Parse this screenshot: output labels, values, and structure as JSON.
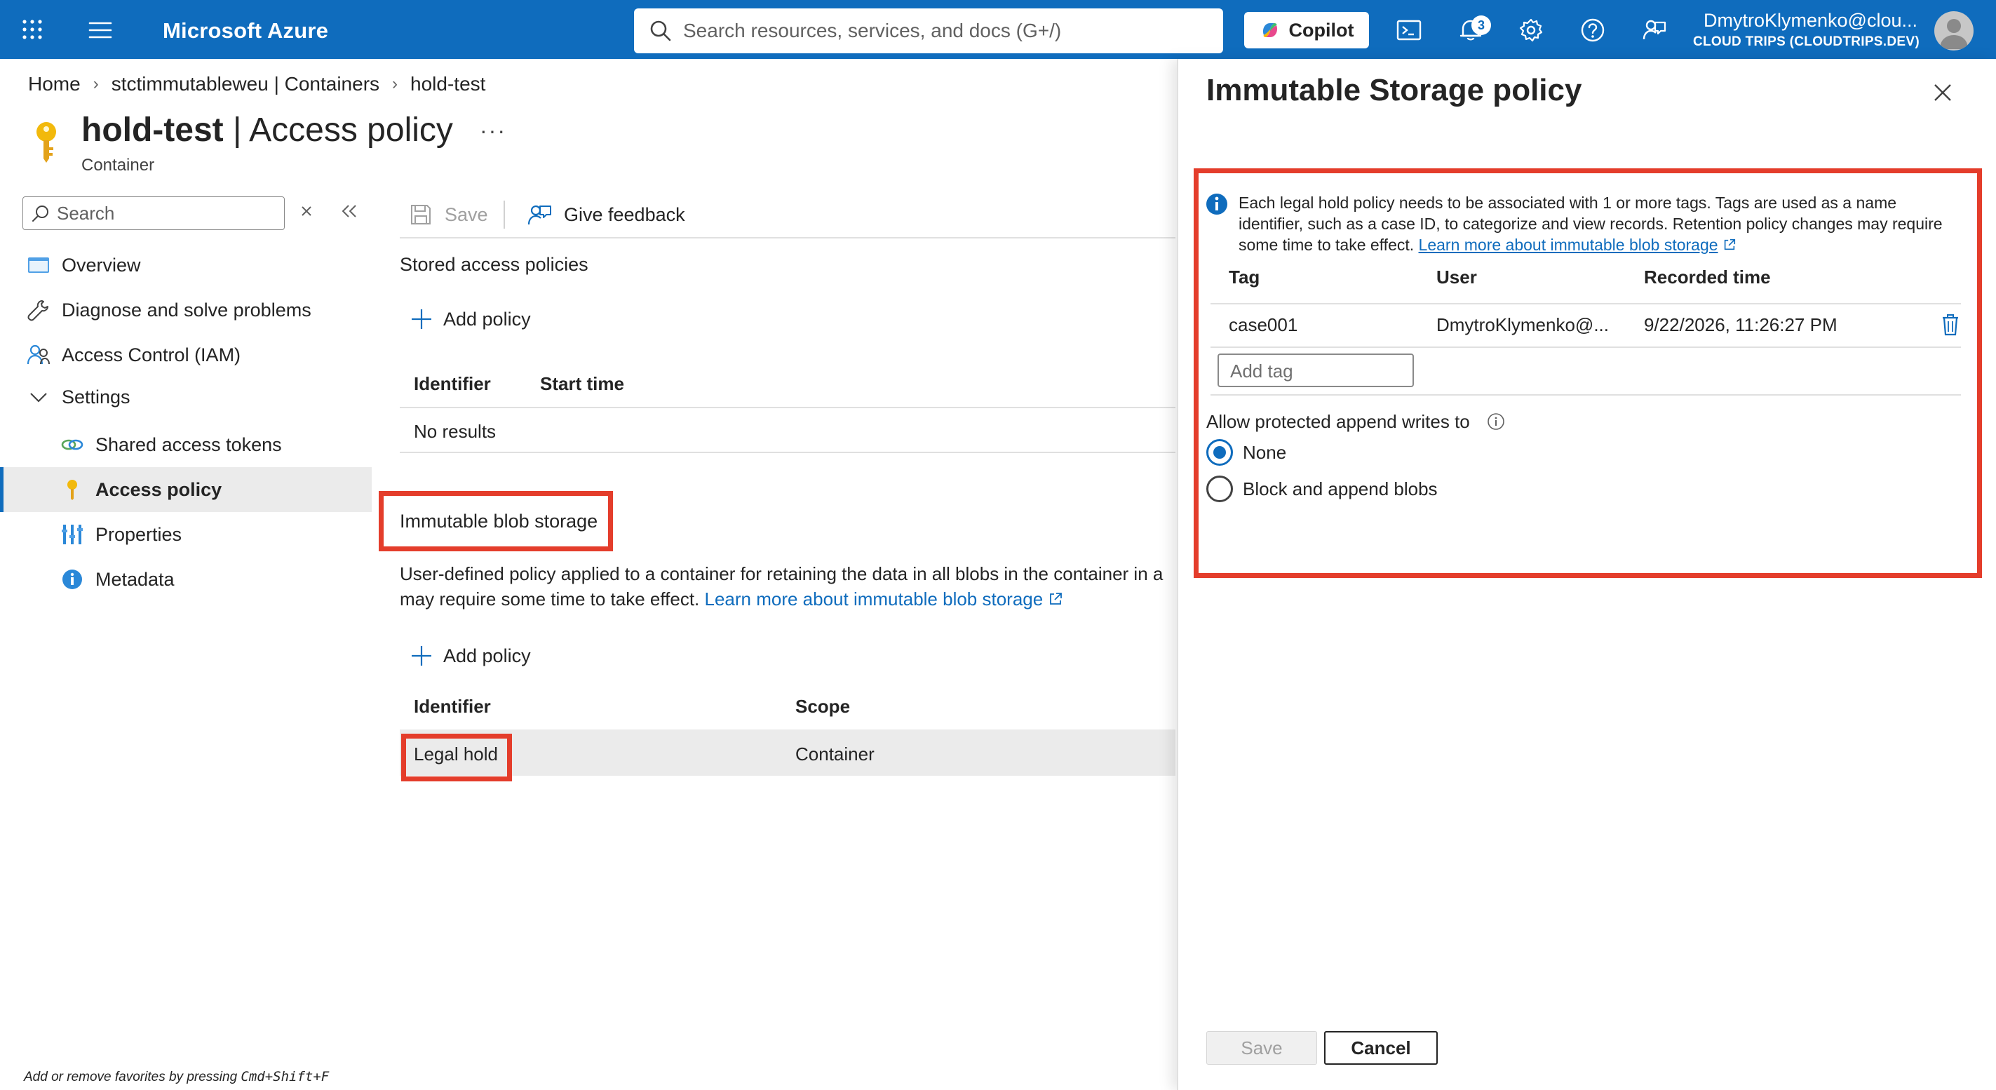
{
  "app": {
    "brand": "Microsoft Azure",
    "search_placeholder": "Search resources, services, and docs (G+/)",
    "copilot_label": "Copilot",
    "notifications_count": "3",
    "user_name": "DmytroKlymenko@clou...",
    "user_directory": "CLOUD TRIPS (CLOUDTRIPS.DEV)"
  },
  "breadcrumb": [
    "Home",
    "stctimmutableweu | Containers",
    "hold-test"
  ],
  "header": {
    "title_bold": "hold-test",
    "title_rest": " | Access policy",
    "more": "···",
    "subtitle": "Container"
  },
  "sidebar": {
    "search_placeholder": "Search",
    "items": [
      {
        "label": "Overview",
        "icon": "overview-icon"
      },
      {
        "label": "Diagnose and solve problems",
        "icon": "wrench-icon"
      },
      {
        "label": "Access Control (IAM)",
        "icon": "people-icon"
      },
      {
        "label": "Settings",
        "icon": "chevron-down-icon"
      },
      {
        "label": "Shared access tokens",
        "icon": "link-icon"
      },
      {
        "label": "Access policy",
        "icon": "key-icon",
        "active": true
      },
      {
        "label": "Properties",
        "icon": "properties-icon"
      },
      {
        "label": "Metadata",
        "icon": "info-icon"
      }
    ],
    "footer_hint_prefix": "Add or remove favorites by pressing ",
    "footer_hint_keys": "Cmd+Shift+F"
  },
  "toolbar": {
    "save": "Save",
    "feedback": "Give feedback"
  },
  "stored": {
    "title": "Stored access policies",
    "add": "Add policy",
    "columns": [
      "Identifier",
      "Start time"
    ],
    "empty": "No results"
  },
  "immutable": {
    "title": "Immutable blob storage",
    "desc_line1": "User-defined policy applied to a container for retaining the data in all blobs in the container in a",
    "desc_line2": "may require some time to take effect. ",
    "link": "Learn more about immutable blob storage",
    "add": "Add policy",
    "columns": [
      "Identifier",
      "Scope"
    ],
    "rows": [
      {
        "identifier": "Legal hold",
        "scope": "Container"
      }
    ]
  },
  "blade": {
    "title": "Immutable Storage policy",
    "info_text": "Each legal hold policy needs to be associated with 1 or more tags. Tags are used as a name identifier, such as a case ID, to categorize and view records. Retention policy changes may require some time to take effect. ",
    "info_link": "Learn more about immutable blob storage",
    "columns": [
      "Tag",
      "User",
      "Recorded time"
    ],
    "rows": [
      {
        "tag": "case001",
        "user": "DmytroKlymenko@...",
        "time": "9/22/2026, 11:26:27 PM"
      }
    ],
    "add_tag_placeholder": "Add tag",
    "append_label": "Allow protected append writes to",
    "options": [
      {
        "label": "None",
        "selected": true
      },
      {
        "label": "Block and append blobs",
        "selected": false
      }
    ],
    "save": "Save",
    "cancel": "Cancel"
  },
  "colors": {
    "azure_blue": "#0f6cbd",
    "highlight_red": "#e43d2b"
  }
}
